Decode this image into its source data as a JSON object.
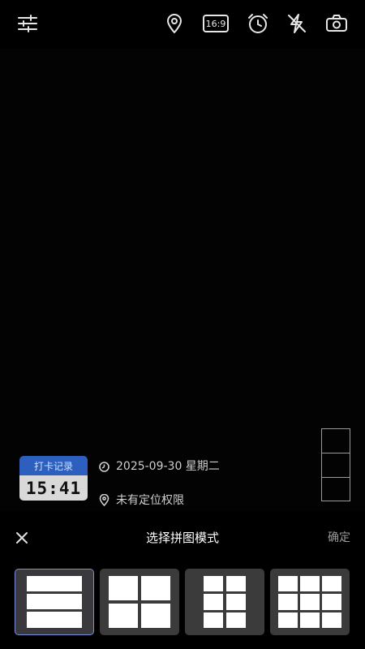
{
  "toolbar": {
    "icons": [
      "settings-sliders-icon",
      "location-pin-icon",
      "aspect-ratio-icon",
      "timer-icon",
      "flash-off-icon",
      "switch-camera-icon"
    ],
    "aspect_ratio_label": "16:9"
  },
  "stamp": {
    "title": "打卡记录",
    "time": "15:41",
    "colors": {
      "header": "#2d5fbf",
      "body": "#d9d9d9"
    }
  },
  "info": {
    "date": "2025-09-30 星期二",
    "location": "未有定位权限"
  },
  "sheet": {
    "title": "选择拼图模式",
    "confirm_label": "确定"
  },
  "modes": [
    {
      "id": "rows-3",
      "selected": true
    },
    {
      "id": "grid-2x2",
      "selected": false
    },
    {
      "id": "grid-2x3",
      "selected": false
    },
    {
      "id": "grid-3x3",
      "selected": false
    }
  ],
  "colors": {
    "background": "#000000",
    "accent": "#7a90d8",
    "tile": "#3b3b3b"
  }
}
